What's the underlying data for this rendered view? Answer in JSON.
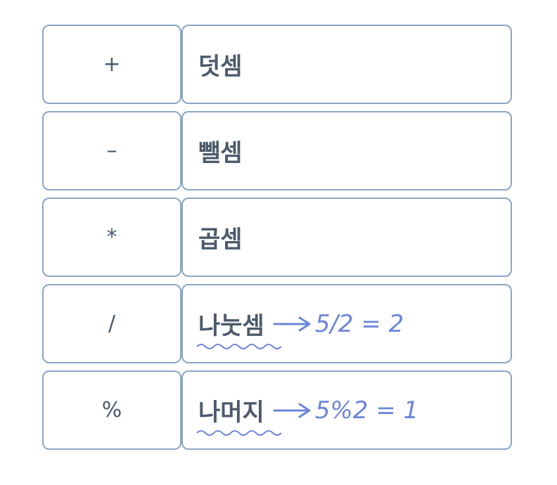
{
  "rows": [
    {
      "operator": "+",
      "label": "덧셈",
      "annotation": ""
    },
    {
      "operator": "–",
      "label": "뺄셈",
      "annotation": ""
    },
    {
      "operator": "*",
      "label": "곱셈",
      "annotation": ""
    },
    {
      "operator": "/",
      "label": "나눗셈",
      "annotation": "5/2 = 2"
    },
    {
      "operator": "%",
      "label": "나머지",
      "annotation": "5%2 = 1"
    }
  ],
  "colors": {
    "border": "#8aa6c6",
    "text": "#4c5a6b",
    "handwriting": "#6c86d8"
  }
}
